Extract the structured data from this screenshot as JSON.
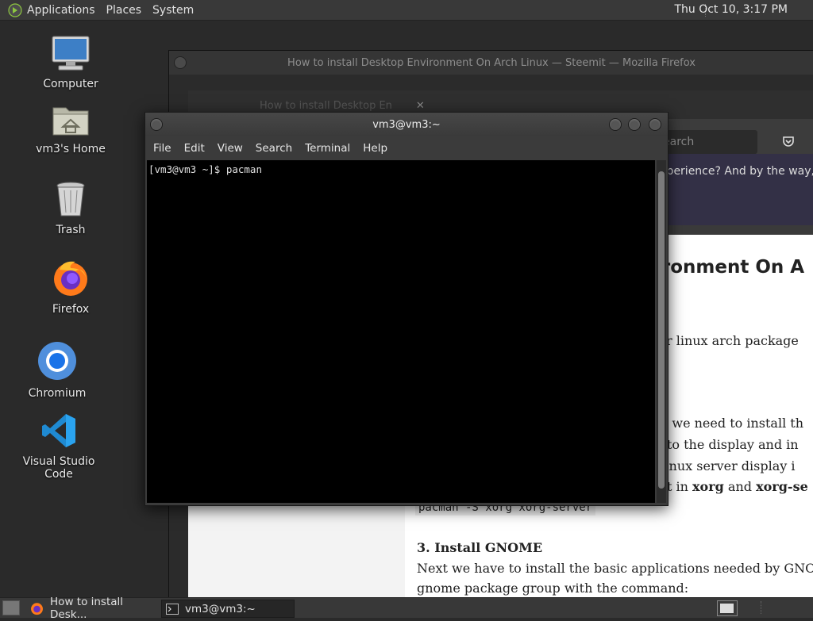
{
  "top_panel": {
    "menus": [
      "Applications",
      "Places",
      "System"
    ],
    "clock": "Thu Oct 10,  3:17 PM"
  },
  "desktop_icons": [
    {
      "label": "Computer",
      "icon": "computer-icon"
    },
    {
      "label": "vm3's Home",
      "icon": "home-folder-icon"
    },
    {
      "label": "Trash",
      "icon": "trash-icon"
    },
    {
      "label": "Firefox",
      "icon": "firefox-icon"
    },
    {
      "label": "Chromium",
      "icon": "chromium-icon"
    },
    {
      "label": "Visual Studio Code",
      "icon": "vscode-icon"
    }
  ],
  "firefox_window": {
    "title": "How to install Desktop Environment On Arch Linux — Steemit — Mozilla Firefox",
    "tab_title": "How to install Desktop En",
    "search_placeholder": "earch",
    "notice": "w experience? And by the way, w",
    "content": {
      "heading": "vironment On A",
      "line1": "your linux arch package",
      "line2": "ent, we need to install th",
      "line3": "ect to the display and in",
      "line4": "ar linux server display i",
      "line5_prefix": "all it in ",
      "line5_bold1": "xorg",
      "line5_mid": " and ",
      "line5_bold2": "xorg-se",
      "code": "pacman -S xorg xorg-server",
      "section": "3. Install GNOME",
      "para1": "Next we have to install the basic applications needed by GNOME",
      "para2": "gnome package group with the command:"
    }
  },
  "terminal": {
    "title": "vm3@vm3:~",
    "menu": [
      "File",
      "Edit",
      "View",
      "Search",
      "Terminal",
      "Help"
    ],
    "prompt_line": "[vm3@vm3 ~]$ pacman"
  },
  "taskbar": {
    "tasks": [
      {
        "label": "How to install Desk...",
        "icon": "firefox-icon",
        "active": false
      },
      {
        "label": "vm3@vm3:~",
        "icon": "terminal-icon",
        "active": true
      }
    ]
  }
}
